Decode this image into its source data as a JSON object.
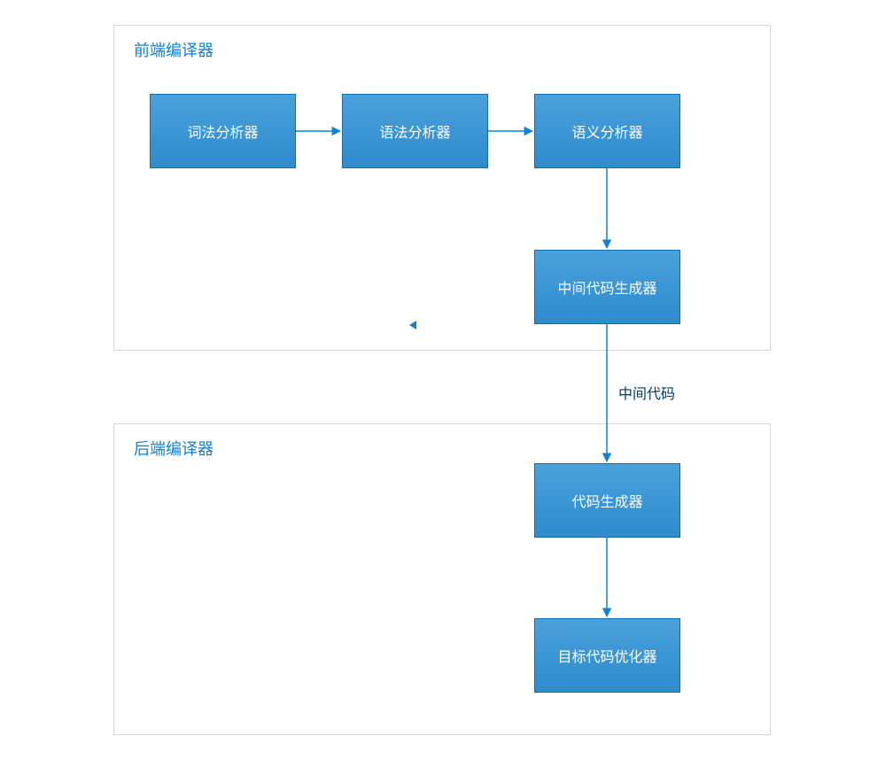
{
  "groups": {
    "frontend_title": "前端编译器",
    "backend_title": "后端编译器"
  },
  "nodes": {
    "lexer": "词法分析器",
    "parser": "语法分析器",
    "semantic": "语义分析器",
    "intermediate_code_generator": "中间代码生成器",
    "code_generator": "代码生成器",
    "target_code_optimizer": "目标代码优化器"
  },
  "edges": {
    "intermediate_code_label": "中间代码"
  },
  "colors": {
    "node_fill_top": "#4ba1db",
    "node_fill_bottom": "#2e8bce",
    "node_border": "#176bab",
    "arrow": "#1282d6",
    "group_border": "#d8d8d8",
    "title": "#1282d6",
    "edge_label": "#003a6a"
  },
  "chart_data": {
    "type": "flowchart",
    "groups": [
      {
        "id": "frontend",
        "label": "前端编译器",
        "nodes": [
          "lexer",
          "parser",
          "semantic",
          "intermediate_code_generator"
        ]
      },
      {
        "id": "backend",
        "label": "后端编译器",
        "nodes": [
          "code_generator",
          "target_code_optimizer"
        ]
      }
    ],
    "nodes": [
      {
        "id": "lexer",
        "label": "词法分析器"
      },
      {
        "id": "parser",
        "label": "语法分析器"
      },
      {
        "id": "semantic",
        "label": "语义分析器"
      },
      {
        "id": "intermediate_code_generator",
        "label": "中间代码生成器"
      },
      {
        "id": "code_generator",
        "label": "代码生成器"
      },
      {
        "id": "target_code_optimizer",
        "label": "目标代码优化器"
      }
    ],
    "edges": [
      {
        "from": "lexer",
        "to": "parser"
      },
      {
        "from": "parser",
        "to": "semantic"
      },
      {
        "from": "semantic",
        "to": "intermediate_code_generator"
      },
      {
        "from": "intermediate_code_generator",
        "to": "code_generator",
        "label": "中间代码"
      },
      {
        "from": "code_generator",
        "to": "target_code_optimizer"
      }
    ]
  }
}
